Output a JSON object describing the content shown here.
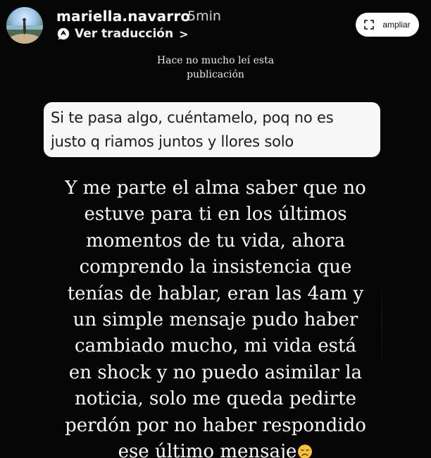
{
  "header": {
    "username": "mariella.navarro",
    "time_ago": "5min",
    "translate_label": "Ver traducción",
    "translate_chevron": ">",
    "ampliar_label": "ampliar",
    "icons": {
      "avatar": "avatar",
      "translate": "translate-icon",
      "expand": "expand-icon"
    }
  },
  "story": {
    "caption_lines": [
      "Hace no mucho leí esta",
      "publicación"
    ],
    "quote_lines": [
      "Si te pasa algo, cuéntamelo, poq no es",
      "justo q riamos juntos y llores solo"
    ],
    "body_lines": [
      "Y me parte el alma saber que no",
      "estuve para ti en los últimos",
      "momentos de tu vida, ahora",
      "comprendo la insistencia que",
      "tenías de hablar, eran las 4am y",
      "un simple mensaje pudo haber",
      "cambiado mucho, mi vida está",
      "en shock y no puedo asimilar la",
      "noticia, solo me queda pedirte",
      "perdón por no haber respondido",
      "ese último mensaje"
    ],
    "emoji": "disappointed-face-emoji"
  },
  "colors": {
    "background": "#050505",
    "text": "#ffffff",
    "quote_bg": "#f7f7f7",
    "quote_text": "#1b1b1b",
    "button_bg": "#ffffff"
  }
}
